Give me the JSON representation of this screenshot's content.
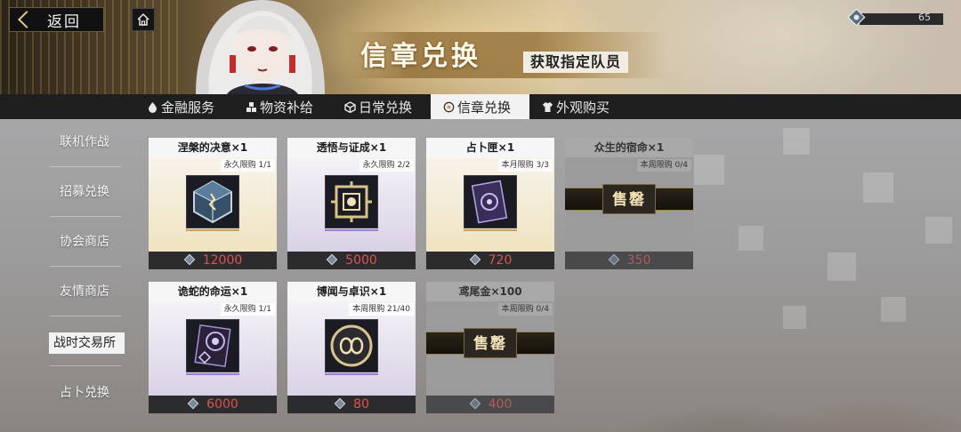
{
  "header": {
    "back_label": "返回",
    "banner_title": "信章兑换",
    "banner_subtitle": "获取指定队员",
    "currency_value": "65"
  },
  "tabs": [
    {
      "label": "金融服务",
      "icon": "coin-drop-icon"
    },
    {
      "label": "物资补给",
      "icon": "supply-boxes-icon"
    },
    {
      "label": "日常兑换",
      "icon": "cube-icon"
    },
    {
      "label": "信章兑换",
      "icon": "badge-icon",
      "active": true
    },
    {
      "label": "外观购买",
      "icon": "shirt-icon"
    }
  ],
  "sidebar": [
    {
      "label": "联机作战"
    },
    {
      "label": "招募兑换"
    },
    {
      "label": "协会商店"
    },
    {
      "label": "友情商店"
    },
    {
      "label": "战时交易所",
      "active": true
    },
    {
      "label": "占卜兑换"
    }
  ],
  "cards": [
    {
      "title": "涅槃的决意×1",
      "limit": "永久限购 1/1",
      "price": "12000",
      "style": "gold",
      "sold_out": false
    },
    {
      "title": "透悟与证成×1",
      "limit": "永久限购 2/2",
      "price": "5000",
      "style": "purple",
      "sold_out": false
    },
    {
      "title": "占卜匣×1",
      "limit": "本月限购 3/3",
      "price": "720",
      "style": "gold",
      "sold_out": false
    },
    {
      "title": "众生的宿命×1",
      "limit": "本周限购 0/4",
      "price": "350",
      "style": "grey",
      "sold_out": true
    },
    {
      "title": "诡蛇的命运×1",
      "limit": "永久限购 1/1",
      "price": "6000",
      "style": "purple",
      "sold_out": false
    },
    {
      "title": "博闻与卓识×1",
      "limit": "本周限购 21/40",
      "price": "80",
      "style": "gold",
      "sold_out": false
    },
    {
      "title": "鸢尾金×100",
      "limit": "本周限购 0/4",
      "price": "400",
      "style": "grey",
      "sold_out": true
    }
  ],
  "sold_out_label": "售罄",
  "colors": {
    "price_red": "#e0524c",
    "gold_accent": "#caa255",
    "tab_bar": "#1f1f1f",
    "active_tab": "#f2f2f2"
  }
}
